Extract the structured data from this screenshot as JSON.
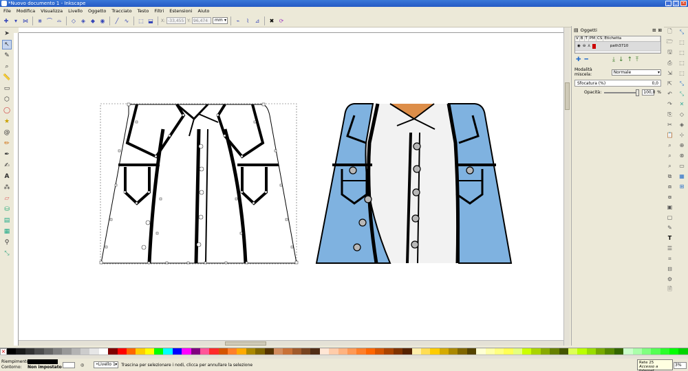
{
  "window": {
    "title": "*Nuovo documento 1 - Inkscape"
  },
  "menu": [
    "File",
    "Modifica",
    "Visualizza",
    "Livello",
    "Oggetto",
    "Tracciato",
    "Testo",
    "Filtri",
    "Estensioni",
    "Aiuto"
  ],
  "toolbar": {
    "x_label": "X:",
    "x_value": "-33,455",
    "y_label": "Y:",
    "y_value": "96,474",
    "unit": "mm"
  },
  "panel": {
    "title": "Oggetti",
    "col_v": "V",
    "col_b": "B",
    "col_t": "T",
    "col_pm": "PM",
    "col_cs": "CS",
    "col_label": "Etichetta",
    "row_label": "path3710",
    "blend_label": "Modalità miscela:",
    "blend_value": "Normale",
    "blur_label": "Sfocatura (%)",
    "blur_value": "0,0",
    "opacity_label": "Opacità:",
    "opacity_value": "100,0",
    "opacity_unit": "%"
  },
  "status": {
    "fill_label": "Riempimento:",
    "stroke_label": "Contorno:",
    "stroke_value": "Non impostato",
    "layer": "•Livello 1",
    "message": "Trascina per selezionare i nodi, clicca per annullare la selezione",
    "tooltip_line1": "Rete 25",
    "tooltip_line2": "Accesso a Internet",
    "zoom": "3%"
  },
  "palette": [
    "#000000",
    "#1a1a1a",
    "#333333",
    "#4d4d4d",
    "#666666",
    "#808080",
    "#999999",
    "#b3b3b3",
    "#cccccc",
    "#e6e6e6",
    "#ffffff",
    "#800000",
    "#ff0000",
    "#ff6600",
    "#ffcc00",
    "#ffff00",
    "#00ff00",
    "#00ffff",
    "#0000ff",
    "#ff00ff",
    "#800080",
    "#ff5599",
    "#ff2a2a",
    "#d45500",
    "#ff7f2a",
    "#ffaa00",
    "#aa8800",
    "#806600",
    "#553300",
    "#d38d5f",
    "#c87137",
    "#a05a2c",
    "#784421",
    "#502d16",
    "#ffe6d5",
    "#ffccaa",
    "#ffb380",
    "#ff9955",
    "#ff7f2a",
    "#ff6600",
    "#d45500",
    "#aa4400",
    "#803300",
    "#552200",
    "#ffeeaa",
    "#ffdd55",
    "#ffcc00",
    "#d4aa00",
    "#aa8800",
    "#806600",
    "#554400",
    "#ffffd5",
    "#ffffaa",
    "#ffff80",
    "#ffff55",
    "#e5ff80",
    "#ccff00",
    "#aad400",
    "#88aa00",
    "#668000",
    "#445500",
    "#ddff55",
    "#bbff00",
    "#99dd00",
    "#77aa00",
    "#558800",
    "#336600",
    "#ccffcc",
    "#aaffaa",
    "#80ff80",
    "#55ff55",
    "#2aff2a",
    "#00ff00",
    "#00d400"
  ],
  "icons": {
    "select": "select-arrow-icon",
    "node": "node-edit-icon"
  }
}
